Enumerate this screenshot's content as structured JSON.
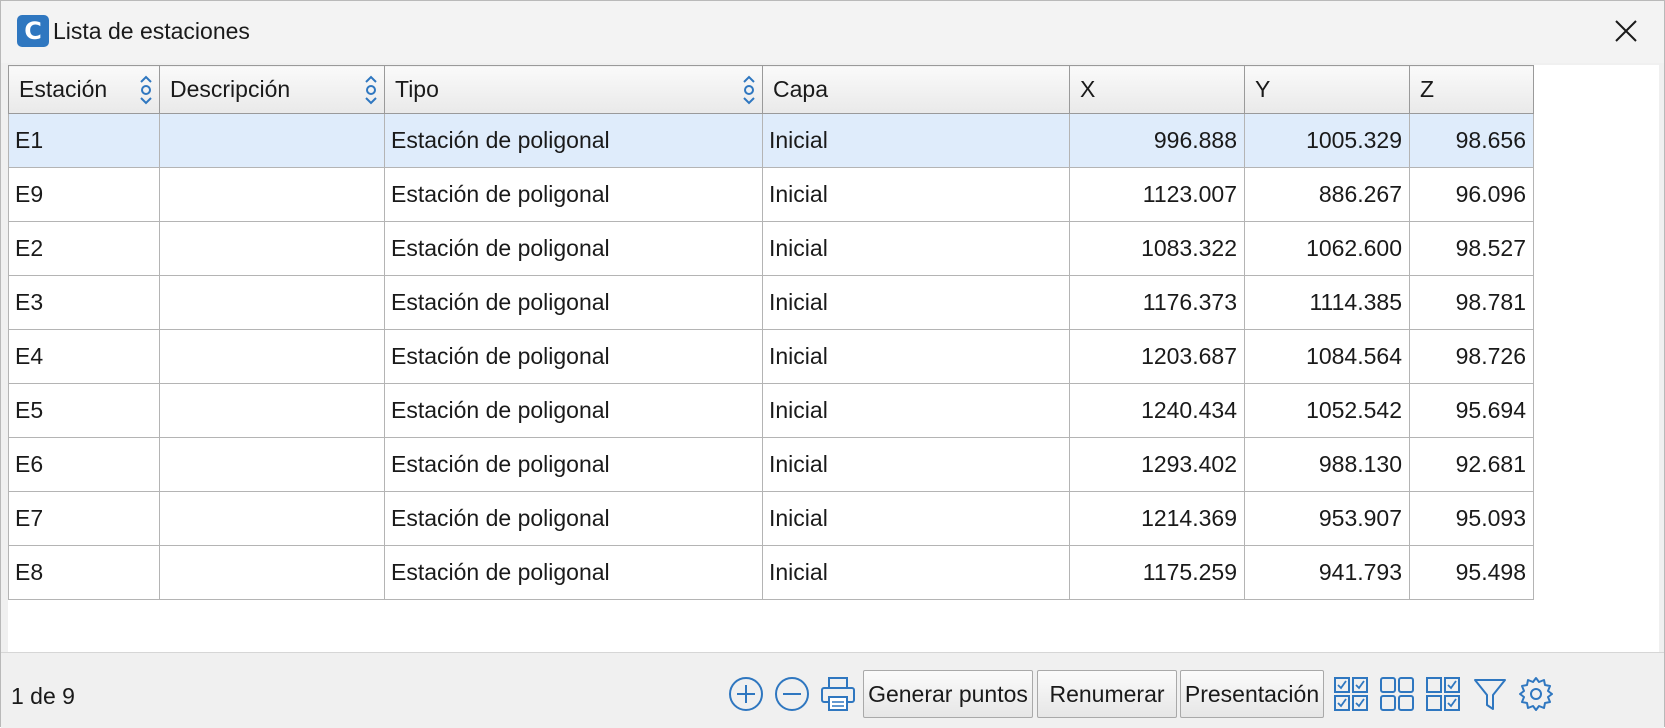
{
  "window": {
    "title": "Lista de estaciones",
    "app_icon_letter": "C",
    "accent": "#2f77c0"
  },
  "table": {
    "columns": [
      {
        "label": "Estación",
        "sortable": true
      },
      {
        "label": "Descripción",
        "sortable": true
      },
      {
        "label": "Tipo",
        "sortable": true
      },
      {
        "label": "Capa",
        "sortable": false
      },
      {
        "label": "X",
        "sortable": false
      },
      {
        "label": "Y",
        "sortable": false
      },
      {
        "label": "Z",
        "sortable": false
      }
    ],
    "selected_row": 0,
    "selected_color": "#dfecfb",
    "rows": [
      {
        "estacion": "E1",
        "descripcion": "",
        "tipo": "Estación de poligonal",
        "capa": "Inicial",
        "x": "996.888",
        "y": "1005.329",
        "z": "98.656"
      },
      {
        "estacion": "E9",
        "descripcion": "",
        "tipo": "Estación de poligonal",
        "capa": "Inicial",
        "x": "1123.007",
        "y": "886.267",
        "z": "96.096"
      },
      {
        "estacion": "E2",
        "descripcion": "",
        "tipo": "Estación de poligonal",
        "capa": "Inicial",
        "x": "1083.322",
        "y": "1062.600",
        "z": "98.527"
      },
      {
        "estacion": "E3",
        "descripcion": "",
        "tipo": "Estación de poligonal",
        "capa": "Inicial",
        "x": "1176.373",
        "y": "1114.385",
        "z": "98.781"
      },
      {
        "estacion": "E4",
        "descripcion": "",
        "tipo": "Estación de poligonal",
        "capa": "Inicial",
        "x": "1203.687",
        "y": "1084.564",
        "z": "98.726"
      },
      {
        "estacion": "E5",
        "descripcion": "",
        "tipo": "Estación de poligonal",
        "capa": "Inicial",
        "x": "1240.434",
        "y": "1052.542",
        "z": "95.694"
      },
      {
        "estacion": "E6",
        "descripcion": "",
        "tipo": "Estación de poligonal",
        "capa": "Inicial",
        "x": "1293.402",
        "y": "988.130",
        "z": "92.681"
      },
      {
        "estacion": "E7",
        "descripcion": "",
        "tipo": "Estación de poligonal",
        "capa": "Inicial",
        "x": "1214.369",
        "y": "953.907",
        "z": "95.093"
      },
      {
        "estacion": "E8",
        "descripcion": "",
        "tipo": "Estación de poligonal",
        "capa": "Inicial",
        "x": "1175.259",
        "y": "941.793",
        "z": "95.498"
      }
    ]
  },
  "footer": {
    "status": "1 de 9",
    "buttons": {
      "generate_points": "Generar puntos",
      "renumber": "Renumerar",
      "presentation": "Presentación"
    },
    "icons": [
      "add-icon",
      "remove-icon",
      "print-icon",
      "select-all-icon",
      "grid-view-icon",
      "deselect-icon",
      "filter-icon",
      "settings-icon"
    ],
    "icon_color": "#2f77c0"
  }
}
